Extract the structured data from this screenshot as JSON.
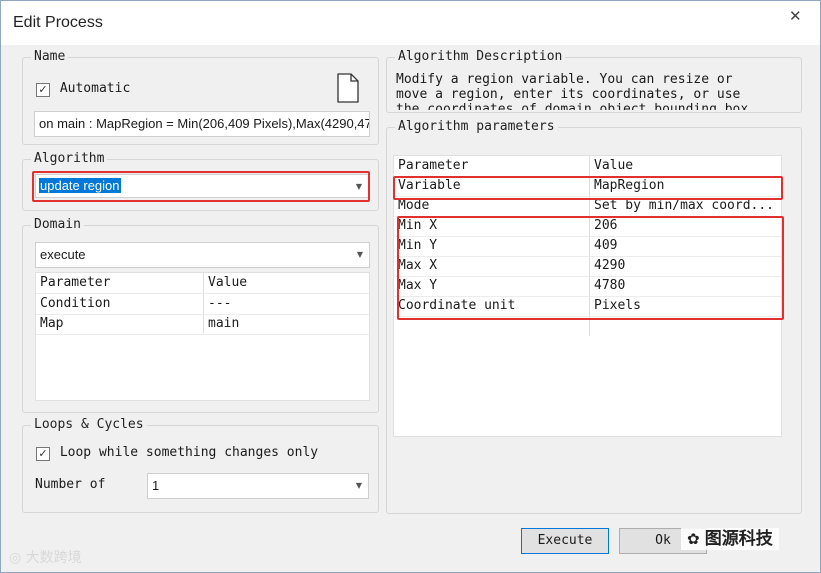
{
  "window": {
    "title": "Edit Process",
    "close_glyph": "✕"
  },
  "name_group": {
    "legend": "Name",
    "automatic_label": "Automatic",
    "automatic_checked": true,
    "name_value": "on main : MapRegion = Min(206,409 Pixels),Max(4290,47"
  },
  "algorithm_group": {
    "legend": "Algorithm",
    "selected": "update region"
  },
  "domain_group": {
    "legend": "Domain",
    "selected": "execute",
    "headers": [
      "Parameter",
      "Value"
    ],
    "rows": [
      {
        "param": "Condition",
        "value": "---"
      },
      {
        "param": "Map",
        "value": "main"
      }
    ]
  },
  "loops_group": {
    "legend": "Loops & Cycles",
    "loop_label": "Loop while something changes only",
    "loop_checked": true,
    "number_label": "Number of",
    "number_value": "1"
  },
  "description_group": {
    "legend": "Algorithm Description",
    "lines": [
      "Modify a region variable. You can resize or",
      "move a region, enter its coordinates, or use",
      "the coordinates of domain object bounding box"
    ]
  },
  "params_group": {
    "legend": "Algorithm parameters",
    "headers": [
      "Parameter",
      "Value"
    ],
    "rows": [
      {
        "param": "Variable",
        "value": "MapRegion"
      },
      {
        "param": "Mode",
        "value": "Set by min/max coord..."
      },
      {
        "param": "Min X",
        "value": "206"
      },
      {
        "param": "Min Y",
        "value": "409"
      },
      {
        "param": "Max X",
        "value": "4290"
      },
      {
        "param": "Max Y",
        "value": "4780"
      },
      {
        "param": "Coordinate unit",
        "value": "Pixels"
      }
    ]
  },
  "buttons": {
    "execute": "Execute",
    "ok": "Ok"
  },
  "watermarks": {
    "left": "大数跨境",
    "right": "图源科技"
  },
  "colors": {
    "highlight": "#0078d7",
    "annotation_red": "#e03030",
    "default_button_border": "#0078d7"
  }
}
